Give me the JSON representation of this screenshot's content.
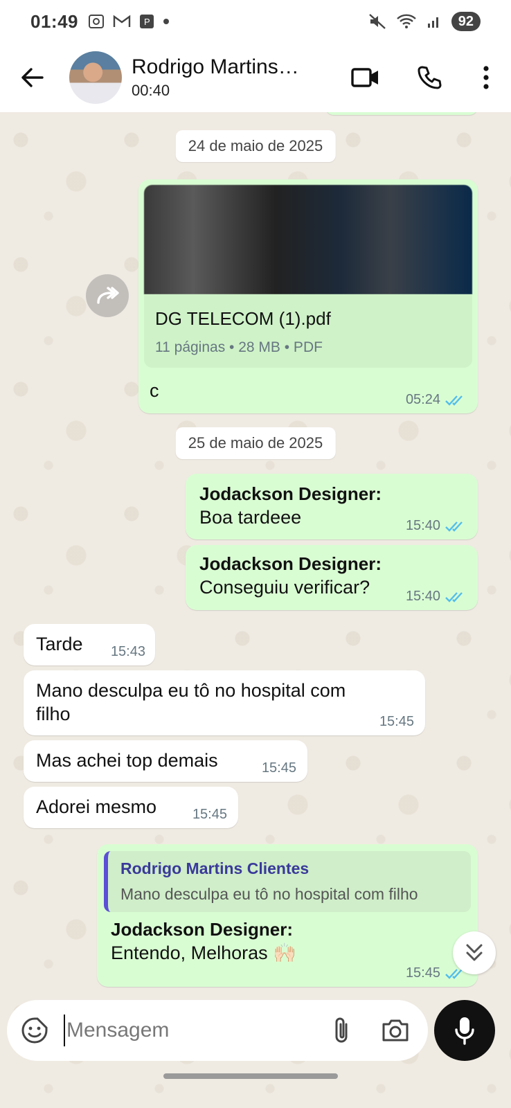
{
  "status_bar": {
    "time": "01:49",
    "battery": "92"
  },
  "header": {
    "contact_name": "Rodrigo Martins…",
    "status": "00:40"
  },
  "dates": {
    "first": "24 de maio de 2025",
    "second": "25 de maio de 2025"
  },
  "messages": [
    {
      "direction": "out",
      "document": {
        "name": "DG TELECOM (1).pdf",
        "meta": "11 páginas • 28 MB • PDF"
      },
      "text": "c",
      "time": "05:24"
    },
    {
      "direction": "out",
      "sender": "Jodackson Designer:",
      "text": "Boa tardeee",
      "time": "15:40"
    },
    {
      "direction": "out",
      "sender": "Jodackson Designer:",
      "text": "Conseguiu verificar?",
      "time": "15:40"
    },
    {
      "direction": "in",
      "text": "Tarde",
      "time": "15:43"
    },
    {
      "direction": "in",
      "text_line1": "Mano desculpa eu tô no hospital  com",
      "text_line2": "filho",
      "time": "15:45"
    },
    {
      "direction": "in",
      "text": "Mas achei top demais",
      "time": "15:45"
    },
    {
      "direction": "in",
      "text": "Adorei mesmo",
      "time": "15:45"
    },
    {
      "direction": "out",
      "quote": {
        "author": "Rodrigo Martins Clientes",
        "text": "Mano desculpa eu tô no hospital  com filho"
      },
      "sender": "Jodackson Designer:",
      "text": "Entendo, Melhoras 🙌🏻",
      "time": "15:45"
    }
  ],
  "composer": {
    "placeholder": "Mensagem"
  },
  "colors": {
    "outgoing": "#d9fdd3",
    "incoming": "#ffffff",
    "chat_bg": "#efeae2",
    "read_tick": "#53bdeb"
  }
}
